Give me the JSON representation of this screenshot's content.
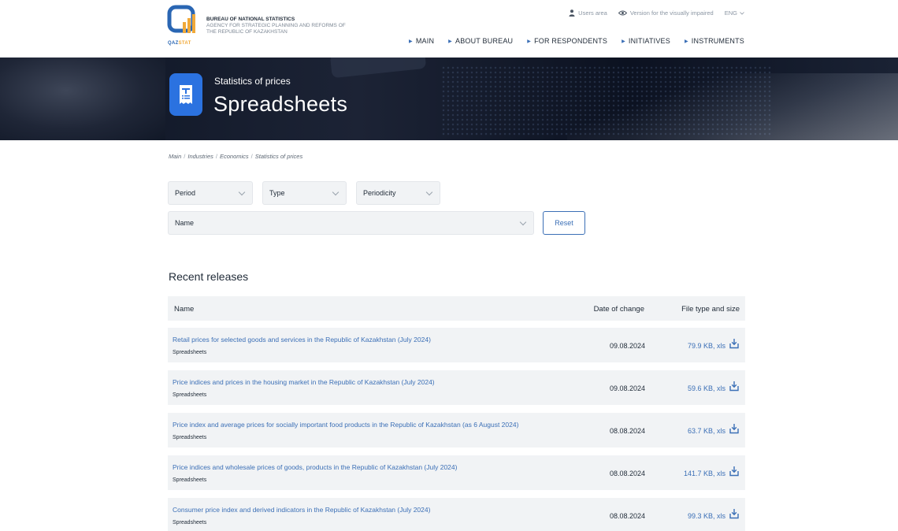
{
  "header": {
    "logo_caption_part1": "QAZ",
    "logo_caption_part2": "STAT",
    "org_title": "BUREAU OF NATIONAL STATISTICS",
    "org_subtitle": "AGENCY FOR STRATEGIC PLANNING AND REFORMS OF THE REPUBLIC OF KAZAKHSTAN",
    "topbar": {
      "users_area": "Users area",
      "visually_impaired": "Version for the visually impaired",
      "language": "ENG"
    },
    "nav": [
      "MAIN",
      "ABOUT BUREAU",
      "FOR RESPONDENTS",
      "INITIATIVES",
      "INSTRUMENTS"
    ]
  },
  "banner": {
    "subtitle": "Statistics of prices",
    "title": "Spreadsheets"
  },
  "breadcrumb": [
    "Main",
    "Industries",
    "Economics",
    "Statistics of prices"
  ],
  "filters": {
    "period": "Period",
    "type": "Type",
    "periodicity": "Periodicity",
    "name": "Name",
    "reset_label": "Reset"
  },
  "releases": {
    "title": "Recent releases",
    "columns": {
      "name": "Name",
      "date": "Date of change",
      "file": "File type and size"
    },
    "rows": [
      {
        "title": "Retail prices for selected goods and services in the Republic of Kazakhstan (July 2024)",
        "category": "Spreadsheets",
        "date": "09.08.2024",
        "file": "79.9 KB, xls"
      },
      {
        "title": "Price indices and prices in the housing market in the Republic of Kazakhstan (July 2024)",
        "category": "Spreadsheets",
        "date": "09.08.2024",
        "file": "59.6 KB, xls"
      },
      {
        "title": "Price index and average prices for socially important food products in the Republic of Kazakhstan (as 6 August 2024)",
        "category": "Spreadsheets",
        "date": "08.08.2024",
        "file": "63.7 KB, xls"
      },
      {
        "title": "Price indices and wholesale prices of goods, products in the Republic of Kazakhstan (July 2024)",
        "category": "Spreadsheets",
        "date": "08.08.2024",
        "file": "141.7 KB, xls"
      },
      {
        "title": "Consumer price index and derived indicators in the Republic of Kazakhstan (July 2024)",
        "category": "Spreadsheets",
        "date": "08.08.2024",
        "file": "99.3 KB, xls"
      }
    ]
  },
  "colors": {
    "accent": "#3b6fb6",
    "icon_blue": "#2b72e0",
    "banner_dark": "#111827",
    "row_bg": "#f1f3f5"
  },
  "icons": [
    "qazstat-logo-icon",
    "user-icon",
    "eye-icon",
    "chevron-down-icon",
    "nav-triangle-icon",
    "spreadsheet-doc-icon",
    "download-icon"
  ]
}
